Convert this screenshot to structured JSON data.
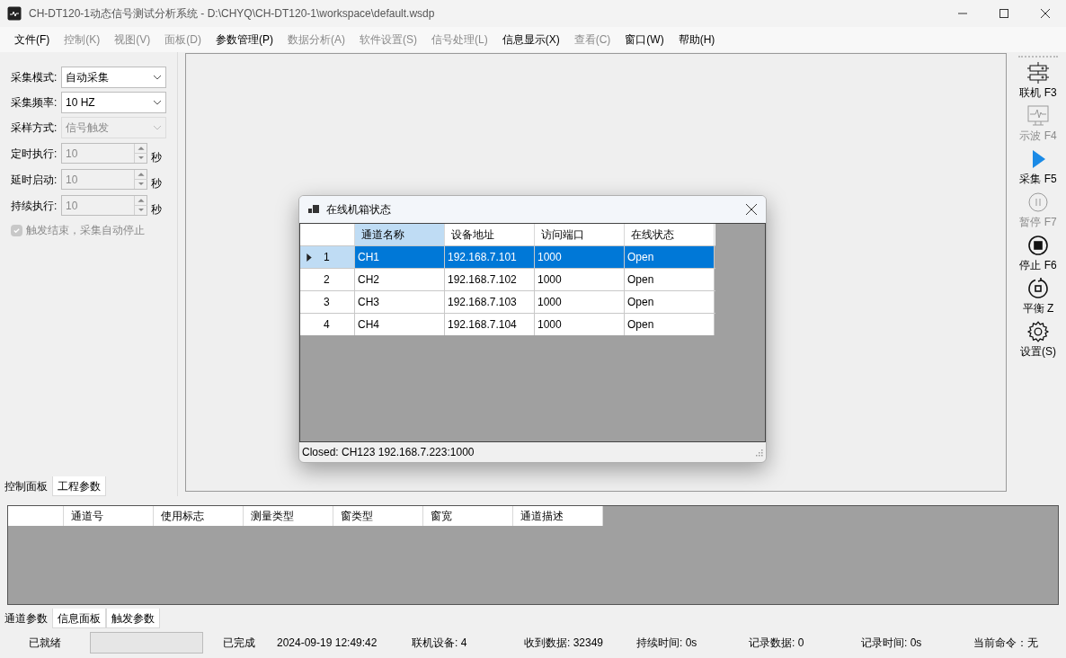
{
  "window": {
    "title": "CH-DT120-1动态信号测试分析系统 - D:\\CHYQ\\CH-DT120-1\\workspace\\default.wsdp"
  },
  "menu": [
    {
      "label": "文件(F)",
      "disabled": false
    },
    {
      "label": "控制(K)",
      "disabled": true
    },
    {
      "label": "视图(V)",
      "disabled": true
    },
    {
      "label": "面板(D)",
      "disabled": true
    },
    {
      "label": "参数管理(P)",
      "disabled": false
    },
    {
      "label": "数据分析(A)",
      "disabled": true
    },
    {
      "label": "软件设置(S)",
      "disabled": true
    },
    {
      "label": "信号处理(L)",
      "disabled": true
    },
    {
      "label": "信息显示(X)",
      "disabled": false
    },
    {
      "label": "查看(C)",
      "disabled": true
    },
    {
      "label": "窗口(W)",
      "disabled": false
    },
    {
      "label": "帮助(H)",
      "disabled": false
    }
  ],
  "control_panel": {
    "fields": [
      {
        "kind": "select",
        "label": "采集模式:",
        "value": "自动采集",
        "disabled": false
      },
      {
        "kind": "select",
        "label": "采集频率:",
        "value": "10 HZ",
        "disabled": false
      },
      {
        "kind": "select",
        "label": "采样方式:",
        "value": "信号触发",
        "disabled": true
      },
      {
        "kind": "spinner",
        "label": "定时执行:",
        "value": "10",
        "unit": "秒",
        "disabled": true
      },
      {
        "kind": "spinner",
        "label": "延时启动:",
        "value": "10",
        "unit": "秒",
        "disabled": true
      },
      {
        "kind": "spinner",
        "label": "持续执行:",
        "value": "10",
        "unit": "秒",
        "disabled": true
      },
      {
        "kind": "checkbox",
        "label": "触发结束，采集自动停止",
        "checked": true,
        "disabled": true
      }
    ],
    "tabs": [
      {
        "label": "控制面板",
        "selected": true
      },
      {
        "label": "工程参数",
        "selected": false
      }
    ]
  },
  "toolbar": [
    {
      "kind": "connect",
      "label": "联机 F3",
      "disabled": false
    },
    {
      "kind": "scope",
      "label": "示波 F4",
      "disabled": true
    },
    {
      "kind": "play",
      "label": "采集 F5",
      "disabled": false
    },
    {
      "kind": "pause",
      "label": "暂停 F7",
      "disabled": true
    },
    {
      "kind": "stop",
      "label": "停止 F6",
      "disabled": false
    },
    {
      "kind": "balance",
      "label": "平衡 Z",
      "disabled": false
    },
    {
      "kind": "settings",
      "label": "设置(S)",
      "disabled": false
    }
  ],
  "dialog": {
    "title": "在线机箱状态",
    "columns": [
      {
        "label": "通道名称",
        "selected": true
      },
      {
        "label": "设备地址",
        "selected": false
      },
      {
        "label": "访问端口",
        "selected": false
      },
      {
        "label": "在线状态",
        "selected": false
      }
    ],
    "rows": [
      {
        "index": "1",
        "cells": [
          "CH1",
          "192.168.7.101",
          "1000",
          "Open"
        ],
        "selected": true
      },
      {
        "index": "2",
        "cells": [
          "CH2",
          "192.168.7.102",
          "1000",
          "Open"
        ],
        "selected": false
      },
      {
        "index": "3",
        "cells": [
          "CH3",
          "192.168.7.103",
          "1000",
          "Open"
        ],
        "selected": false
      },
      {
        "index": "4",
        "cells": [
          "CH4",
          "192.168.7.104",
          "1000",
          "Open"
        ],
        "selected": false
      }
    ],
    "status": "Closed: CH123 192.168.7.223:1000"
  },
  "channel_table": {
    "columns": [
      "通道号",
      "使用标志",
      "测量类型",
      "窗类型",
      "窗宽",
      "通道描述"
    ]
  },
  "bottom_tabs": [
    {
      "label": "通道参数",
      "selected": true
    },
    {
      "label": "信息面板",
      "selected": false
    },
    {
      "label": "触发参数",
      "selected": false
    }
  ],
  "status_bar": {
    "state": "已就绪",
    "progress": {
      "level": 0
    },
    "items": [
      "已完成",
      "2024-09-19 12:49:42",
      "联机设备: 4",
      "收到数据: 32349",
      "持续时间: 0s",
      "记录数据: 0",
      "记录时间: 0s",
      "当前命令：无"
    ]
  }
}
